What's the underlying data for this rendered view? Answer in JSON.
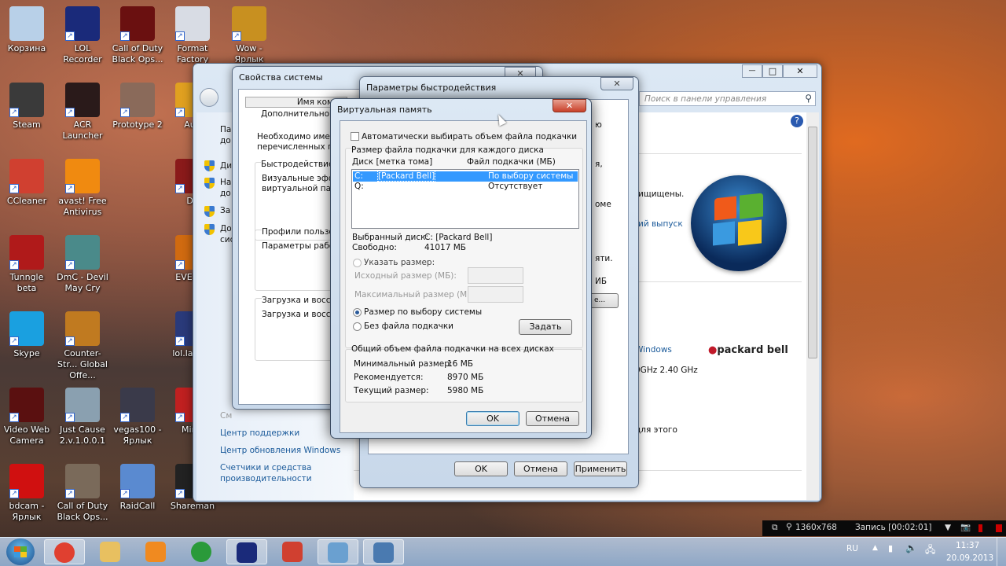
{
  "desktop": {
    "icons": [
      {
        "label": "Корзина",
        "color": "#b8d0e8",
        "col": 0,
        "row": 0,
        "sc": false
      },
      {
        "label": "LOL Recorder",
        "color": "#1a2a7a",
        "col": 1,
        "row": 0,
        "sc": true
      },
      {
        "label": "Call of Duty Black Ops...",
        "color": "#6a1010",
        "col": 2,
        "row": 0,
        "sc": true
      },
      {
        "label": "Format Factory",
        "color": "#d8dce4",
        "col": 3,
        "row": 0,
        "sc": true
      },
      {
        "label": "Wow - Ярлык",
        "color": "#c89020",
        "col": 4,
        "row": 0,
        "sc": true
      },
      {
        "label": "Steam",
        "color": "#3a3a3a",
        "col": 0,
        "row": 1,
        "sc": true
      },
      {
        "label": "ACR Launcher",
        "color": "#2a1a1a",
        "col": 1,
        "row": 1,
        "sc": true
      },
      {
        "label": "Prototype 2",
        "color": "#8a6a5a",
        "col": 2,
        "row": 1,
        "sc": true
      },
      {
        "label": "Aud",
        "color": "#e0a020",
        "col": 3,
        "row": 1,
        "sc": true
      },
      {
        "label": "CCleaner",
        "color": "#d04030",
        "col": 0,
        "row": 2,
        "sc": true
      },
      {
        "label": "avast! Free Antivirus",
        "color": "#f08a10",
        "col": 1,
        "row": 2,
        "sc": true
      },
      {
        "label": "Do",
        "color": "#8a1a1a",
        "col": 3,
        "row": 2,
        "sc": true
      },
      {
        "label": "Tunngle beta",
        "color": "#b01a1a",
        "col": 0,
        "row": 3,
        "sc": true
      },
      {
        "label": "DmC - Devil May Cry",
        "color": "#4a8a8a",
        "col": 1,
        "row": 3,
        "sc": true
      },
      {
        "label": "EVE Ulti",
        "color": "#d06a10",
        "col": 3,
        "row": 3,
        "sc": true
      },
      {
        "label": "Skype",
        "color": "#1aa0e0",
        "col": 0,
        "row": 4,
        "sc": true
      },
      {
        "label": "Counter-Str... Global Offe...",
        "color": "#c07a20",
        "col": 1,
        "row": 4,
        "sc": true
      },
      {
        "label": "lol.lau Яр",
        "color": "#2a3a7a",
        "col": 3,
        "row": 4,
        "sc": true
      },
      {
        "label": "Video Web Camera",
        "color": "#5a1010",
        "col": 0,
        "row": 5,
        "sc": true
      },
      {
        "label": "Just Cause 2.v.1.0.0.1",
        "color": "#8aa0b0",
        "col": 1,
        "row": 5,
        "sc": true
      },
      {
        "label": "vegas100 - Ярлык",
        "color": "#3a3a4a",
        "col": 2,
        "row": 5,
        "sc": true
      },
      {
        "label": "Mirro",
        "color": "#c02020",
        "col": 3,
        "row": 5,
        "sc": true
      },
      {
        "label": "bdcam - Ярлык",
        "color": "#d01010",
        "col": 0,
        "row": 6,
        "sc": true
      },
      {
        "label": "Call of Duty Black Ops...",
        "color": "#7a6a5a",
        "col": 1,
        "row": 6,
        "sc": true
      },
      {
        "label": "RaidCall",
        "color": "#5a8ad0",
        "col": 2,
        "row": 6,
        "sc": true
      },
      {
        "label": "Shareman",
        "color": "#222",
        "col": 3,
        "row": 6,
        "sc": true
      }
    ]
  },
  "control_panel": {
    "search_placeholder": "Поиск в панели управления",
    "left_fragments": [
      "Па",
      "до",
      "Ди",
      "На",
      "до",
      "За",
      "До",
      "сис"
    ],
    "links": {
      "see_also": "См",
      "support": "Центр поддержки",
      "update": "Центр обновления Windows",
      "perf1": "Счетчики и средства",
      "perf2": "производительности"
    },
    "right": {
      "protected": "ищищены.",
      "edition_link": "ий выпуск",
      "windows_link": "Windows",
      "cpu": "0GHz  2.40 GHz",
      "for_this": "для этого",
      "brand": "packard bell"
    },
    "buttons": {
      "minimize": "—",
      "maximize": "□",
      "close": "✕"
    }
  },
  "system_properties": {
    "title": "Свойства системы",
    "tab_name": "Имя компь",
    "tab_advanced": "Дополнительно",
    "need": "Необходимо иметь",
    "listed": "перечисленных пар",
    "perf_group": "Быстродействие",
    "perf_text1": "Визуальные эффе",
    "perf_text2": "виртуальной памя",
    "profiles_group": "Профили пользова",
    "profiles_text": "Параметры рабоче",
    "boot_group": "Загрузка и восста",
    "boot_text": "Загрузка и восста",
    "close": "✕"
  },
  "performance_options": {
    "title": "Параметры быстродействия",
    "close": "✕",
    "fragments": [
      "ю",
      "я,",
      "оме",
      "яти.",
      "ИБ",
      "е..."
    ],
    "ok": "OK",
    "cancel": "Отмена",
    "apply": "Применить"
  },
  "virtual_memory": {
    "title": "Виртуальная память",
    "close": "✕",
    "auto_label": "Автоматически выбирать объем файла подкачки",
    "auto_checked": false,
    "per_disk_label": "Размер файла подкачки для каждого диска",
    "col_disk": "Диск [метка тома]",
    "col_file": "Файл подкачки (МБ)",
    "drives": [
      {
        "drive": "C:",
        "label": "[Packard Bell]",
        "file": "По выбору системы",
        "selected": true
      },
      {
        "drive": "Q:",
        "label": "",
        "file": "Отсутствует",
        "selected": false
      }
    ],
    "selected_disk_label": "Выбранный диск:",
    "selected_disk_value": "C:  [Packard Bell]",
    "free_label": "Свободно:",
    "free_value": "41017 МБ",
    "custom_label": "Указать размер:",
    "initial_label": "Исходный размер (МБ):",
    "max_label": "Максимальный размер (МБ):",
    "initial_value": "",
    "max_value": "",
    "system_managed_label": "Размер по выбору системы",
    "no_file_label": "Без файла подкачки",
    "selected_option": "system_managed",
    "set_button": "Задать",
    "total_label": "Общий объем файла подкачки на всех дисках",
    "min_label": "Минимальный размер:",
    "min_value": "16 МБ",
    "rec_label": "Рекомендуется:",
    "rec_value": "8970 МБ",
    "cur_label": "Текущий размер:",
    "cur_value": "5980 МБ",
    "ok": "OK",
    "cancel": "Отмена"
  },
  "recorder": {
    "resolution": "1360x768",
    "status": "Запись [00:02:01]"
  },
  "taskbar": {
    "lang": "RU",
    "time": "11:37",
    "date": "20.09.2013",
    "items": [
      {
        "name": "chrome",
        "color": "#e04030"
      },
      {
        "name": "explorer",
        "color": "#e8c060"
      },
      {
        "name": "media-player",
        "color": "#f08a20"
      },
      {
        "name": "utorrent",
        "color": "#2a9a3a"
      },
      {
        "name": "lol",
        "color": "#1a2a7a"
      },
      {
        "name": "ccleaner",
        "color": "#d04030"
      },
      {
        "name": "control-panel",
        "color": "#6aa0d0"
      },
      {
        "name": "system-properties",
        "color": "#4a7ab0"
      }
    ]
  }
}
